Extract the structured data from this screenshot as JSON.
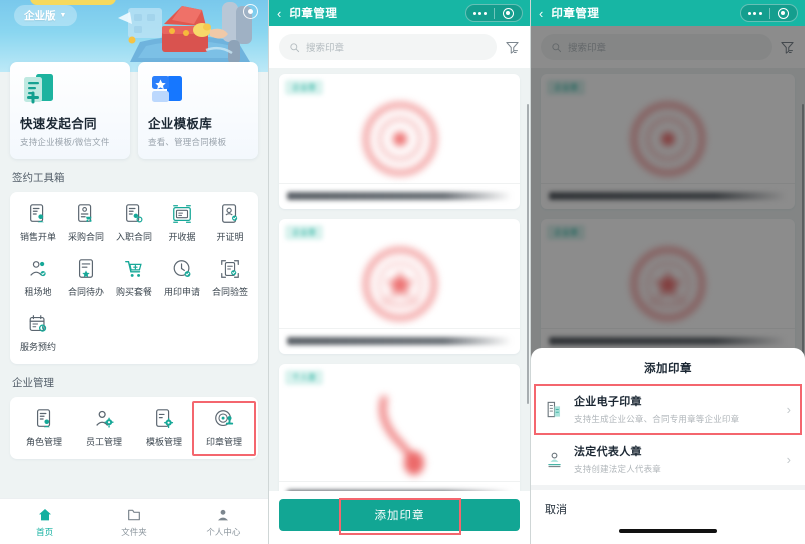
{
  "left_panel": {
    "hero": {
      "edition_badge": "企业版",
      "caret": "▼",
      "camera_icon": "record-icon"
    },
    "feature_cards": [
      {
        "title": "快速发起合同",
        "subtitle": "支持企业模板/微信文件",
        "icon": "document-plus-icon"
      },
      {
        "title": "企业模板库",
        "subtitle": "查看、管理合同模板",
        "icon": "template-star-icon"
      }
    ],
    "toolbox": {
      "section_title": "签约工具箱",
      "items": [
        {
          "label": "销售开单",
          "icon": "doc-person-icon"
        },
        {
          "label": "采购合同",
          "icon": "doc-cart-icon"
        },
        {
          "label": "入职合同",
          "icon": "doc-onboard-icon"
        },
        {
          "label": "开收据",
          "icon": "receipt-icon"
        },
        {
          "label": "开证明",
          "icon": "certificate-icon"
        },
        {
          "label": "租场地",
          "icon": "venue-icon"
        },
        {
          "label": "合同待办",
          "icon": "todo-doc-icon"
        },
        {
          "label": "购买套餐",
          "icon": "cart-plus-icon"
        },
        {
          "label": "用印申请",
          "icon": "seal-apply-icon"
        },
        {
          "label": "合同验签",
          "icon": "verify-doc-icon"
        },
        {
          "label": "服务预约",
          "icon": "calendar-clock-icon"
        }
      ]
    },
    "enterprise": {
      "section_title": "企业管理",
      "items": [
        {
          "label": "角色管理",
          "icon": "role-doc-icon",
          "highlighted": false
        },
        {
          "label": "员工管理",
          "icon": "staff-gear-icon",
          "highlighted": false
        },
        {
          "label": "模板管理",
          "icon": "template-gear-icon",
          "highlighted": false
        },
        {
          "label": "印章管理",
          "icon": "seal-manage-icon",
          "highlighted": true
        }
      ]
    },
    "tabbar": [
      {
        "label": "首页",
        "icon": "home-icon",
        "active": true
      },
      {
        "label": "文件夹",
        "icon": "folder-icon",
        "active": false
      },
      {
        "label": "个人中心",
        "icon": "person-icon",
        "active": false
      }
    ]
  },
  "mid_panel": {
    "header": {
      "back_icon": "back-chevron-icon",
      "title": "印章管理",
      "capsule_more_icon": "more-dots-icon",
      "capsule_target_icon": "target-icon"
    },
    "search": {
      "placeholder": "搜索印章",
      "search_icon": "search-icon",
      "filter_icon": "filter-funnel-icon"
    },
    "seal_cards": [
      {
        "badge": "企业章",
        "stamp_type": "round-red-seal",
        "name": "（已模糊）企业电子印章名称"
      },
      {
        "badge": "企业章",
        "stamp_type": "round-red-seal-star",
        "name": "（已模糊）合同专用章名称"
      },
      {
        "badge": "个人章",
        "stamp_type": "red-signature-mark",
        "name": "（已模糊）法定代表人章"
      }
    ],
    "add_button": {
      "label": "添加印章",
      "highlighted": true
    }
  },
  "right_panel": {
    "header": {
      "back_icon": "back-chevron-icon",
      "title": "印章管理",
      "capsule_more_icon": "more-dots-icon",
      "capsule_target_icon": "target-icon"
    },
    "search": {
      "placeholder": "搜索印章",
      "search_icon": "search-icon",
      "filter_icon": "filter-funnel-icon"
    },
    "action_sheet": {
      "title": "添加印章",
      "options": [
        {
          "label": "企业电子印章",
          "subtitle": "支持生成企业公章、合同专用章等企业印章",
          "icon": "building-seal-icon",
          "chevron": "›",
          "highlighted": true
        },
        {
          "label": "法定代表人章",
          "subtitle": "支持创建法定人代表章",
          "icon": "person-seal-icon",
          "chevron": "›",
          "highlighted": false
        }
      ],
      "cancel_label": "取消"
    }
  },
  "colors": {
    "brand_teal": "#17b6a4",
    "button_teal": "#12a694",
    "highlight_red": "#f4666e",
    "page_bg": "#eef3f3",
    "seal_red": "#e86a6a"
  }
}
